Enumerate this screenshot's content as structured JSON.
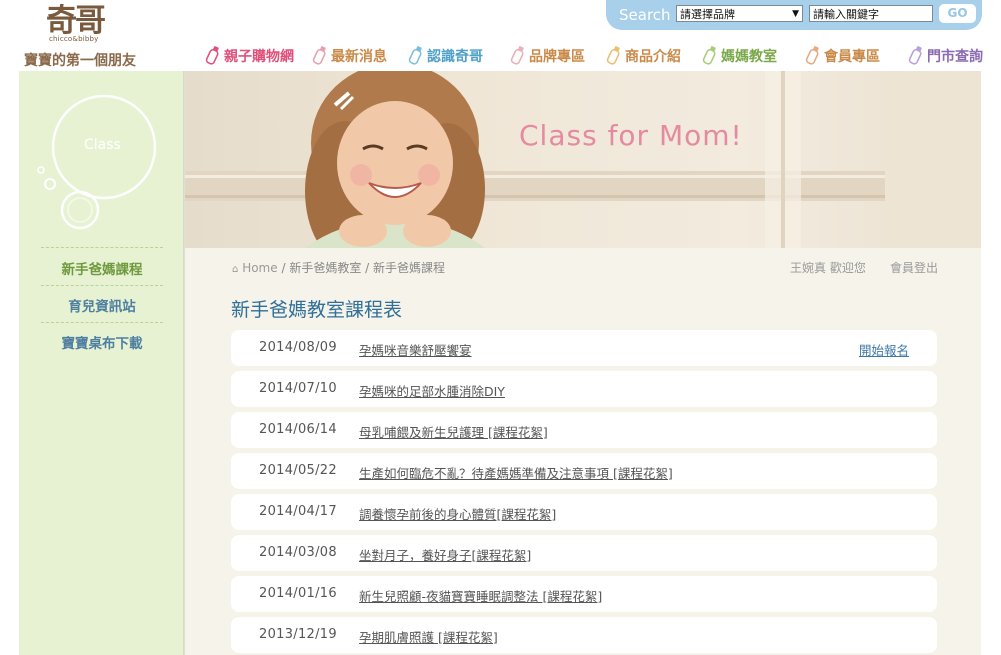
{
  "header": {
    "logo_cn": "奇哥",
    "logo_en": "chicco&bibby",
    "slogan": "寶寶的第一個朋友",
    "search": {
      "label": "Search",
      "brand_select": "請選擇品牌",
      "keyword_value": "請輸入關鍵字",
      "go": "GO"
    },
    "nav": [
      {
        "label": "親子購物網",
        "color": "#e0507a"
      },
      {
        "label": "最新消息",
        "color": "#c98a4a"
      },
      {
        "label": "認識奇哥",
        "color": "#4fa0c8"
      },
      {
        "label": "品牌專區",
        "color": "#c98a4a"
      },
      {
        "label": "商品介紹",
        "color": "#c98a4a"
      },
      {
        "label": "媽媽教室",
        "color": "#7aa84a"
      },
      {
        "label": "會員專區",
        "color": "#c98a4a"
      },
      {
        "label": "門市查詢",
        "color": "#8a6ab0"
      }
    ]
  },
  "sidebar": {
    "circle_label": "Class",
    "links": [
      {
        "label": "新手爸媽課程",
        "active": true
      },
      {
        "label": "育兒資訊站",
        "active": false
      },
      {
        "label": "寶寶桌布下載",
        "active": false
      }
    ]
  },
  "hero": {
    "text": "Class for Mom!"
  },
  "breadcrumb": {
    "home": "Home",
    "sep": "/",
    "level1": "新手爸媽教室",
    "level2": "新手爸媽課程"
  },
  "user": {
    "welcome": "王婉真 歡迎您",
    "logout": "會員登出"
  },
  "page_title": "新手爸媽教室課程表",
  "courses": [
    {
      "date": "2014/08/09",
      "title": "孕媽咪音樂舒壓饗宴",
      "action": "開始報名"
    },
    {
      "date": "2014/07/10",
      "title": "孕媽咪的足部水腫消除DIY",
      "action": ""
    },
    {
      "date": "2014/06/14",
      "title": "母乳哺餵及新生兒護理 [課程花絮]",
      "action": ""
    },
    {
      "date": "2014/05/22",
      "title": "生產如何臨危不亂？待產媽媽準備及注意事項 [課程花絮]",
      "action": ""
    },
    {
      "date": "2014/04/17",
      "title": "調養懷孕前後的身心體質[課程花絮]",
      "action": ""
    },
    {
      "date": "2014/03/08",
      "title": "坐對月子，養好身子[課程花絮]",
      "action": ""
    },
    {
      "date": "2014/01/16",
      "title": "新生兒照顧-夜貓寶寶睡眠調整法 [課程花絮]",
      "action": ""
    },
    {
      "date": "2013/12/19",
      "title": "孕期肌膚照護 [課程花絮]",
      "action": ""
    }
  ]
}
